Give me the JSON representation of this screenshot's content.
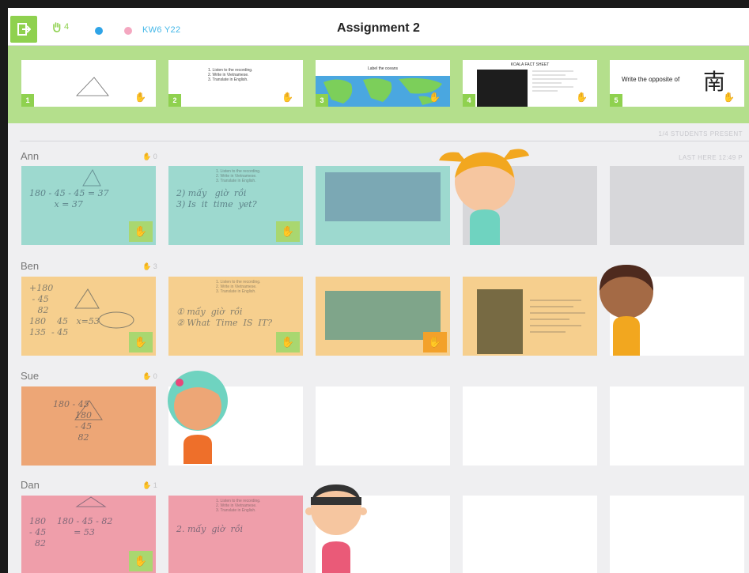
{
  "header": {
    "title": "Assignment 2",
    "hand_count": "4",
    "class_code": "KW6 Y22",
    "exit_icon": "exit-icon",
    "hand_icon": "raised-hand-icon"
  },
  "slides": [
    {
      "number": "1",
      "hand": "✋",
      "content": ""
    },
    {
      "number": "2",
      "hand": "✋",
      "content": "1. Listen to the recording.\n2. Write in Vietnamese.\n3. Translate in English."
    },
    {
      "number": "3",
      "hand": "✋",
      "content": "Label the oceans"
    },
    {
      "number": "4",
      "hand": "✋",
      "content": "KOALA FACT SHEET"
    },
    {
      "number": "5",
      "hand": "✋",
      "content": "Write the opposite of",
      "character": "南"
    }
  ],
  "students_present": "1/4 STUDENTS PRESENT",
  "students": [
    {
      "name": "Ann",
      "hand_count": "0",
      "last_here": "LAST HERE 12:49 P"
    },
    {
      "name": "Ben",
      "hand_count": "3"
    },
    {
      "name": "Sue",
      "hand_count": "0"
    },
    {
      "name": "Dan",
      "hand_count": "1"
    }
  ],
  "work": {
    "ann_1": "180 - 45 - 45 = 37\n         x = 37",
    "ann_2": "2) mấy   giờ  rồi\n3) Is  it  time  yet?",
    "ben_1": "+180\n - 45\n   82\n180    45   x=53\n135  - 45",
    "ben_2": "① mấy  giờ  rồi\n② What  Time  IS  IT?",
    "sue_1": "180 - 45\n        180\n        - 45\n         82",
    "dan_1": "180    180 - 45 - 82\n- 45          = 53\n  82",
    "dan_2": "2. mấy  giờ  rồi",
    "worksheet_lines": "1. Listen to the recording.\n2. Write in Vietnamese.\n3. Translate in English."
  },
  "colors": {
    "accent_green": "#8fd14f",
    "strip_green": "#b4df8c",
    "ann": "#9dd9cf",
    "ben": "#f6cf8e",
    "sue": "#eda676",
    "dan": "#ef9eaa"
  }
}
